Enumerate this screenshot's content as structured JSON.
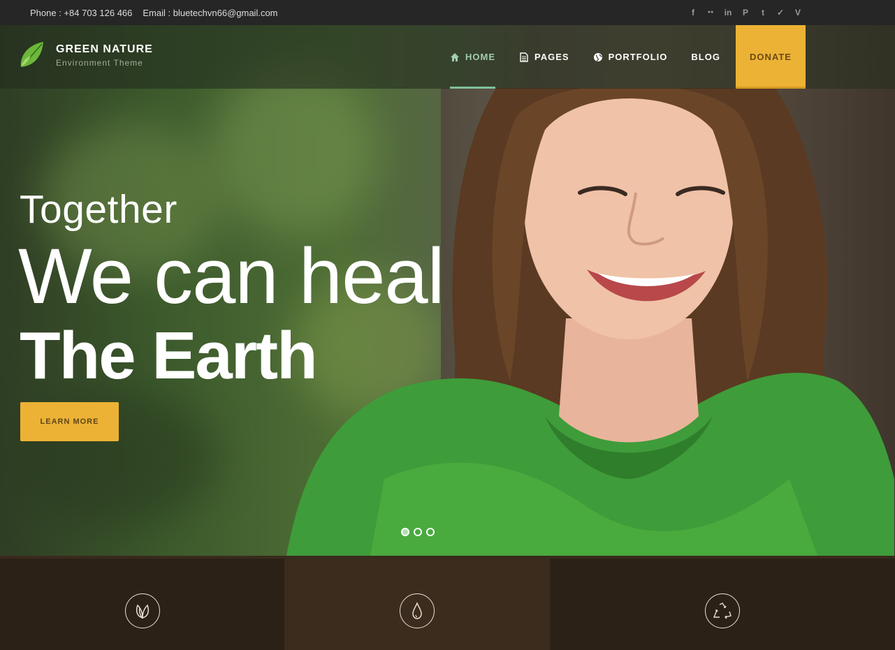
{
  "topbar": {
    "phone": "Phone : +84 703 126 466",
    "email": "Email : bluetechvn66@gmail.com",
    "socials": [
      {
        "icon": "facebook-icon",
        "glyph": "f"
      },
      {
        "icon": "flickr-icon",
        "glyph": "●●"
      },
      {
        "icon": "linkedin-icon",
        "glyph": "in"
      },
      {
        "icon": "pinterest-icon",
        "glyph": "P"
      },
      {
        "icon": "tumblr-icon",
        "glyph": "t"
      },
      {
        "icon": "twitter-icon",
        "glyph": "✓"
      },
      {
        "icon": "vimeo-icon",
        "glyph": "V"
      }
    ]
  },
  "brand": {
    "name": "GREEN NATURE",
    "tagline": "Environment Theme"
  },
  "nav": {
    "items": [
      {
        "label": "HOME",
        "icon": "home-icon",
        "active": true
      },
      {
        "label": "PAGES",
        "icon": "page-icon",
        "active": false
      },
      {
        "label": "PORTFOLIO",
        "icon": "globe-icon",
        "active": false
      },
      {
        "label": "BLOG",
        "icon": "",
        "active": false
      }
    ],
    "donate": "DONATE"
  },
  "hero": {
    "line1": "Together",
    "line2": "We can heal",
    "line3": "The Earth",
    "cta": "LEARN MORE",
    "slides": 3,
    "current_slide": 1
  },
  "features": [
    {
      "icon": "leaf-icon"
    },
    {
      "icon": "water-drop-icon"
    },
    {
      "icon": "recycle-icon"
    }
  ],
  "colors": {
    "accent": "#ecb235",
    "nav_active": "#9fcdb0",
    "footer_dark": "#2c2116",
    "footer_mid": "#3b2c1e"
  }
}
